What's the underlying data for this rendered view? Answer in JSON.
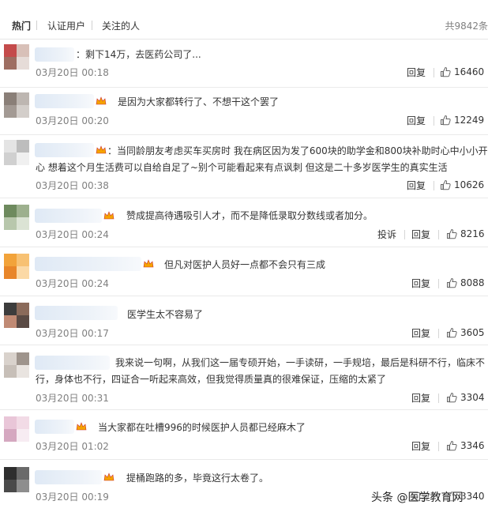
{
  "tabs": [
    {
      "label": "热门",
      "active": true
    },
    {
      "label": "认证用户",
      "active": false
    },
    {
      "label": "关注的人",
      "active": false
    }
  ],
  "total_count": "共9842条",
  "actions": {
    "reply": "回复",
    "report": "投诉"
  },
  "colors": {
    "crown": "#f5a300",
    "time": "#808080"
  },
  "comments": [
    {
      "text": "：剩下14万，去医药公司了...",
      "time": "03月20日 00:18",
      "likes": "16460"
    },
    {
      "text": "是因为大家都转行了、不想干这个罢了",
      "time": "03月20日 00:20",
      "likes": "12249"
    },
    {
      "text_line1": "：当同龄朋友考虑买车买房时 我在病区因为发了600块的助学金和800块补助时心中小小开",
      "text_line2": "心 想着这个月生活费可以自给自足了~别个可能看起来有点讽刺 但这是二十多岁医学生的真实生活",
      "time": "03月20日 00:38",
      "likes": "10626"
    },
    {
      "text": "赞成提高待遇吸引人才，而不是降低录取分数线或者加分。",
      "time": "03月20日 00:24",
      "likes": "8216"
    },
    {
      "text": "但凡对医护人员好一点都不会只有三成",
      "time": "03月20日 00:24",
      "likes": "8088"
    },
    {
      "text": "医学生太不容易了",
      "time": "03月20日 00:17",
      "likes": "3605"
    },
    {
      "text_line1": "我来说一句啊，从我们这一届专硕开始，一手读研，一手规培，最后是科研不行，临床不",
      "text_line2": "行，身体也不行，四证合一听起来高效，但我觉得质量真的很难保证，压缩的太紧了",
      "time": "03月20日 00:31",
      "likes": "3304"
    },
    {
      "text": "当大家都在吐槽996的时候医护人员都已经麻木了",
      "time": "03月20日 01:02",
      "likes": "3346"
    },
    {
      "text": "提桶跑路的多，毕竟这行太卷了。",
      "time": "03月20日 00:19",
      "likes": "3340"
    }
  ],
  "watermark": "头条 @医学教育网"
}
